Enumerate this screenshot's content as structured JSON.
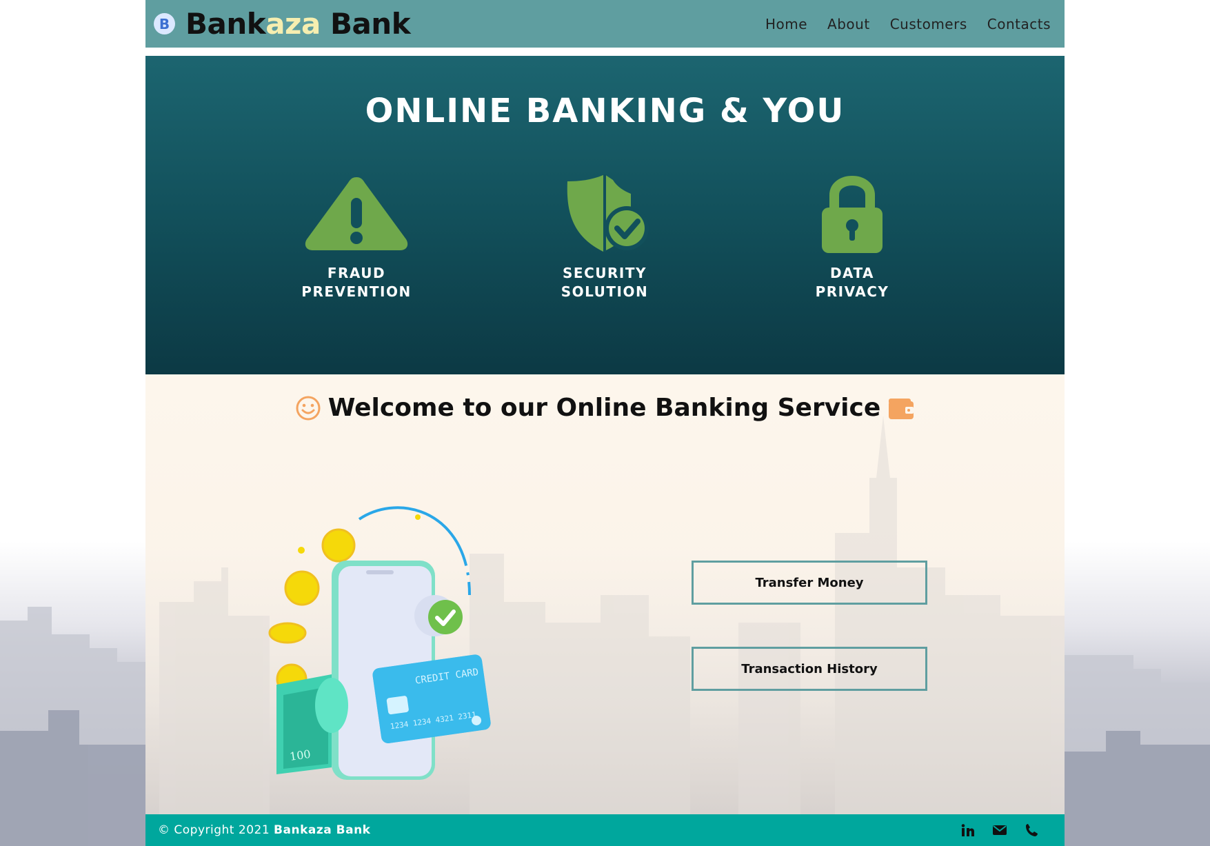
{
  "header": {
    "logo_letter": "B",
    "brand_part1": "Bank",
    "brand_part2": "aza",
    "brand_part3": " Bank",
    "nav": [
      "Home",
      "About",
      "Customers",
      "Contacts"
    ]
  },
  "hero": {
    "title": "ONLINE BANKING & YOU",
    "features": [
      {
        "label": "FRAUD\nPREVENTION",
        "icon": "warning-icon"
      },
      {
        "label": "SECURITY\nSOLUTION",
        "icon": "shield-check-icon"
      },
      {
        "label": "DATA\nPRIVACY",
        "icon": "padlock-icon"
      }
    ],
    "icon_color": "#6fa84b"
  },
  "main": {
    "welcome": "Welcome to our Online Banking Service",
    "illustration_text": {
      "card_label": "CREDIT CARD",
      "card_number": "1234 1234 4321 2311",
      "banknote_value": "100"
    },
    "buttons": {
      "transfer": "Transfer Money",
      "history": "Transaction History"
    }
  },
  "footer": {
    "copyright": "© Copyright 2021 ",
    "brand": "Bankaza Bank",
    "social": [
      "linkedin-icon",
      "email-icon",
      "phone-icon"
    ]
  },
  "colors": {
    "header": "#5f9ea0",
    "hero_top": "#1c6570",
    "hero_bottom": "#0c3944",
    "footer": "#00a79d",
    "accent_orange": "#f4a460",
    "button_border": "#5f9ea0"
  }
}
